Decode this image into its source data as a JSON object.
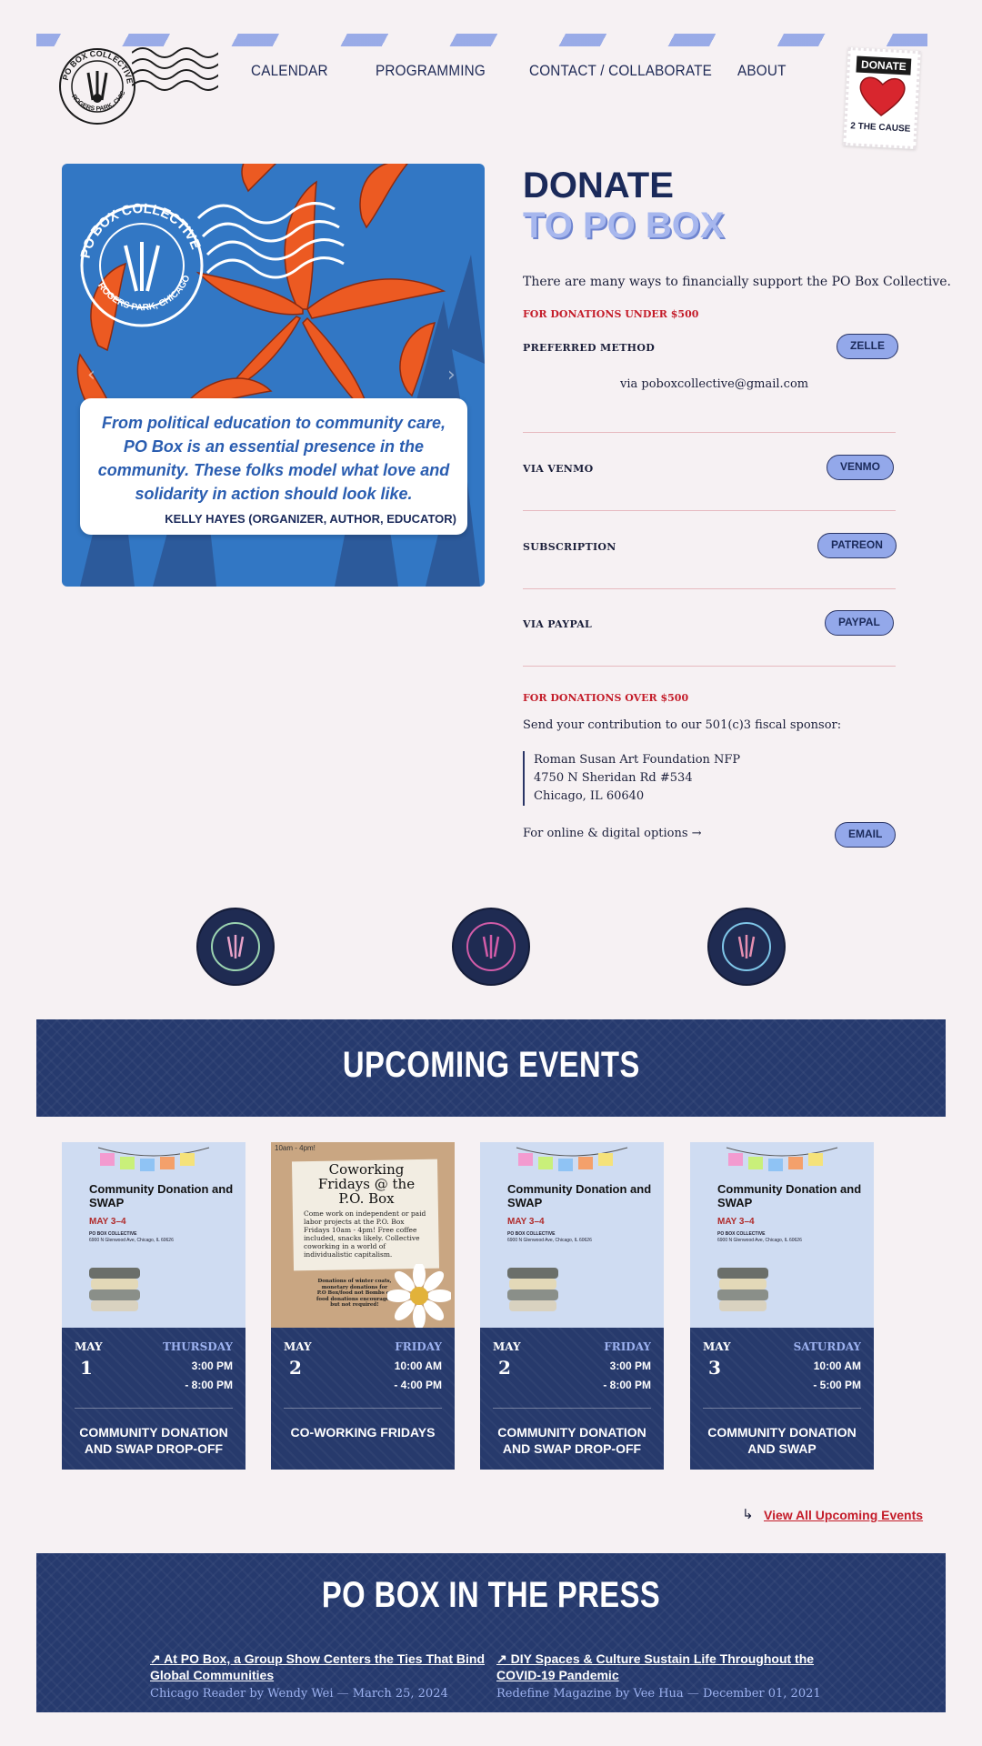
{
  "header": {
    "logo_text": "PO BOX COLLECTIVE · ROGERS PARK, CHICAGO",
    "nav": [
      "CALENDAR",
      "PROGRAMMING",
      "CONTACT / COLLABORATE",
      "ABOUT"
    ],
    "donate_stamp": {
      "tag": "DONATE",
      "caption": "2 THE CAUSE"
    }
  },
  "hero": {
    "quote": "From political education to community care, PO Box is an essential presence in the community. These folks model what love and solidarity in action should look like.",
    "author": "KELLY HAYES (ORGANIZER, AUTHOR, EDUCATOR)",
    "stamp_text": "PO BOX COLLECTIVE",
    "stamp_sub": "ROGERS PARK, CHICAGO",
    "prev": "‹",
    "next": "›"
  },
  "donate": {
    "title": "DONATE",
    "subtitle": "TO PO BOX",
    "intro": "There are many ways to financially support the PO Box Collective.",
    "under_label": "FOR DONATIONS UNDER $500",
    "methods": [
      {
        "label": "PREFERRED METHOD",
        "button": "ZELLE",
        "note": "via poboxcollective@gmail.com"
      },
      {
        "label": "VIA VENMO",
        "button": "VENMO"
      },
      {
        "label": "SUBSCRIPTION",
        "button": "PATREON"
      },
      {
        "label": "VIA PAYPAL",
        "button": "PAYPAL"
      }
    ],
    "over_label": "FOR DONATIONS OVER $500",
    "sponsor_intro": "Send your contribution to our 501(c)3 fiscal sponsor:",
    "address": [
      "Roman Susan Art Foundation NFP",
      "4750 N Sheridan Rd #534",
      "Chicago, IL 60640"
    ],
    "online": "For online & digital options →",
    "email_button": "EMAIL"
  },
  "events": {
    "heading": "UPCOMING EVENTS",
    "items": [
      {
        "month": "MAY",
        "day": "1",
        "weekday": "THURSDAY",
        "start": "3:00 PM",
        "end": "- 8:00 PM",
        "title": "COMMUNITY DONATION AND SWAP DROP-OFF",
        "poster": "swap"
      },
      {
        "month": "MAY",
        "day": "2",
        "weekday": "FRIDAY",
        "start": "10:00 AM",
        "end": "- 4:00 PM",
        "title": "CO-WORKING FRIDAYS",
        "poster": "cowork"
      },
      {
        "month": "MAY",
        "day": "2",
        "weekday": "FRIDAY",
        "start": "3:00 PM",
        "end": "- 8:00 PM",
        "title": "COMMUNITY DONATION AND SWAP DROP-OFF",
        "poster": "swap"
      },
      {
        "month": "MAY",
        "day": "3",
        "weekday": "SATURDAY",
        "start": "10:00 AM",
        "end": "- 5:00 PM",
        "title": "COMMUNITY DONATION AND SWAP",
        "poster": "swap"
      }
    ],
    "swap_poster": {
      "title": "Community Donation and SWAP",
      "dates": "MAY 3–4",
      "host": "PO BOX COLLECTIVE",
      "address": "6900 N Glenwood Ave, Chicago, IL 60626"
    },
    "cowork_poster": {
      "time": "10am - 4pm!",
      "title": "Coworking Fridays @ the P.O. Box",
      "body": "Come work on independent or paid labor projects at the P.O. Box Fridays 10am - 4pm! Free coffee included, snacks likely. Collective coworking in a world of individualistic capitalism.",
      "note": "Donations of winter coats, monetary donations for P.O Box/food not Bombs or food donations encouraged but not required!"
    },
    "view_all": "View All Upcoming Events"
  },
  "press": {
    "heading": "PO BOX IN THE PRESS",
    "items": [
      {
        "title": "At PO Box, a Group Show Centers the Ties That Bind Global Communities",
        "source": "Chicago Reader by Wendy Wei",
        "date": "March 25, 2024"
      },
      {
        "title": "DIY Spaces & Culture Sustain Life Throughout the COVID-19 Pandemic",
        "source": "Redefine Magazine by Vee Hua",
        "date": "December 01, 2021"
      }
    ]
  },
  "colors": {
    "navy": "#263a6e",
    "periwinkle": "#93a8ea",
    "accent_red": "#c41d2a",
    "background": "#f6f1f3"
  }
}
